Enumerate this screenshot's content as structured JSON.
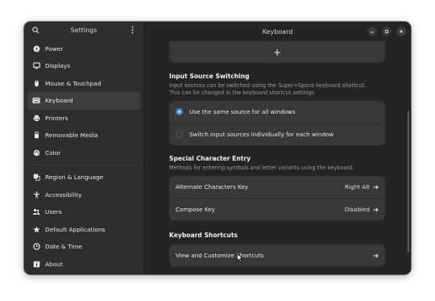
{
  "sidebar": {
    "title": "Settings",
    "items_top": [
      {
        "label": "Power",
        "icon": "power-icon"
      },
      {
        "label": "Displays",
        "icon": "display-icon"
      },
      {
        "label": "Mouse & Touchpad",
        "icon": "mouse-icon"
      },
      {
        "label": "Keyboard",
        "icon": "keyboard-icon",
        "active": true
      },
      {
        "label": "Printers",
        "icon": "printer-icon"
      },
      {
        "label": "Removable Media",
        "icon": "usb-icon"
      },
      {
        "label": "Color",
        "icon": "color-icon"
      }
    ],
    "items_bottom": [
      {
        "label": "Region & Language",
        "icon": "region-icon"
      },
      {
        "label": "Accessibility",
        "icon": "accessibility-icon"
      },
      {
        "label": "Users",
        "icon": "users-icon"
      },
      {
        "label": "Default Applications",
        "icon": "star-icon"
      },
      {
        "label": "Date & Time",
        "icon": "clock-icon"
      },
      {
        "label": "About",
        "icon": "info-icon"
      }
    ]
  },
  "header": {
    "title": "Keyboard"
  },
  "add_button": {
    "label": "+"
  },
  "input_source": {
    "title": "Input Source Switching",
    "description_line1": "Input sources can be switched using the Super+Space keyboard shortcut.",
    "description_line2": "This can be changed in the keyboard shortcut settings.",
    "options": [
      {
        "label": "Use the same source for all windows",
        "selected": true
      },
      {
        "label": "Switch input sources individually for each window",
        "selected": false
      }
    ]
  },
  "special_char": {
    "title": "Special Character Entry",
    "description": "Methods for entering symbols and letter variants using the keyboard.",
    "rows": [
      {
        "label": "Alternate Characters Key",
        "value": "Right Alt"
      },
      {
        "label": "Compose Key",
        "value": "Disabled"
      }
    ]
  },
  "shortcuts": {
    "title": "Keyboard Shortcuts",
    "row_label": "View and Customize Shortcuts"
  },
  "colors": {
    "accent": "#3584e4",
    "window_bg": "#242424",
    "sidebar_bg": "#2e2e2e",
    "card_bg": "#383838"
  }
}
